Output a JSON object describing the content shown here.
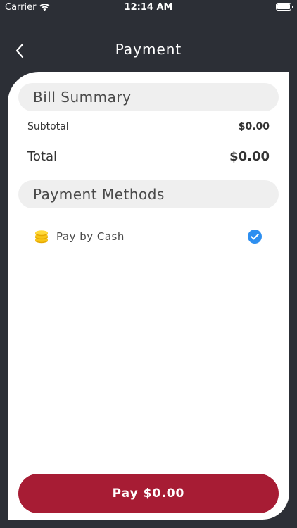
{
  "status_bar": {
    "carrier": "Carrier",
    "time": "12:14 AM"
  },
  "nav": {
    "title": "Payment"
  },
  "bill_summary": {
    "header": "Bill Summary",
    "subtotal_label": "Subtotal",
    "subtotal_value": "$0.00",
    "total_label": "Total",
    "total_value": "$0.00"
  },
  "payment_methods": {
    "header": "Payment Methods",
    "items": [
      {
        "label": "Pay by Cash",
        "icon": "coins-icon",
        "selected": true
      }
    ]
  },
  "pay_button": {
    "label": "Pay $0.00"
  },
  "colors": {
    "background": "#2c2f36",
    "accent": "#a71c34",
    "check": "#2e8ff0"
  }
}
